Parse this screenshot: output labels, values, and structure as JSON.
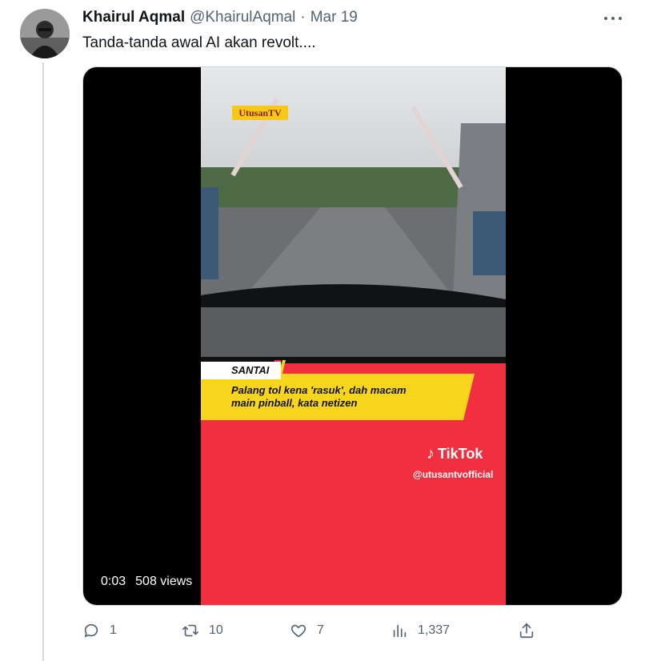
{
  "tweet": {
    "author_name": "Khairul Aqmal",
    "author_handle": "@KhairulAqmal",
    "separator": "·",
    "date": "Mar 19",
    "text": "Tanda-tanda awal AI akan revolt...."
  },
  "video": {
    "channel_logo": "UtusanTV",
    "tag": "SANTAI",
    "caption_line1": "Palang tol kena 'rasuk', dah macam",
    "caption_line2": "main pinball, kata netizen",
    "watermark_label": "TikTok",
    "watermark_handle": "@utusantvofficial",
    "elapsed": "0:03",
    "views": "508 views"
  },
  "actions": {
    "replies": "1",
    "retweets": "10",
    "likes": "7",
    "views": "1,337"
  },
  "icons": [
    "avatar",
    "more-icon",
    "reply-icon",
    "retweet-icon",
    "like-icon",
    "views-icon",
    "share-icon",
    "tiktok-icon"
  ],
  "colors": {
    "text_primary": "#0f1419",
    "text_secondary": "#536471",
    "border": "#cfd9de",
    "video_red": "#f22f3e",
    "video_yellow": "#f7d51d"
  }
}
